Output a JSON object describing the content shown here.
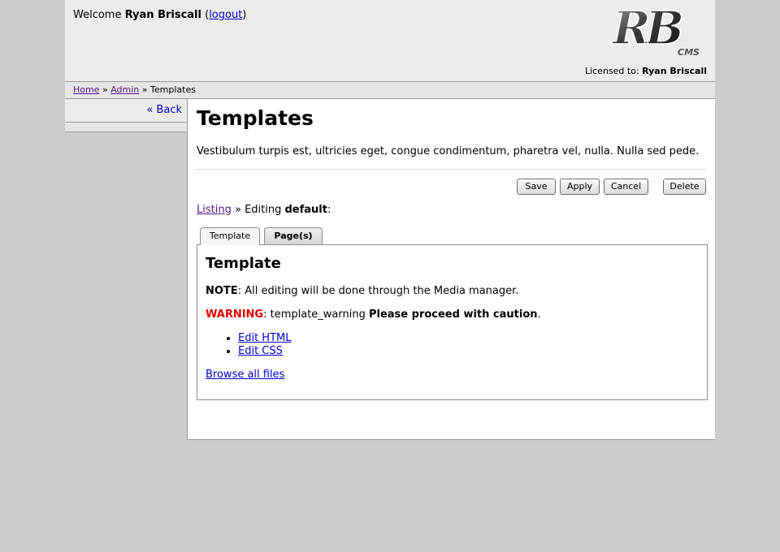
{
  "header": {
    "welcome_prefix": "Welcome",
    "user_name": "Ryan Briscall",
    "logout_label": "logout",
    "licensed_label": "Licensed to:",
    "licensed_name": "Ryan Briscall",
    "logo_text": "RB",
    "logo_subtext": "CMS"
  },
  "breadcrumb": {
    "items": [
      "Home",
      "Admin",
      "Templates"
    ],
    "separator": "»"
  },
  "sidebar": {
    "back_label": "« Back"
  },
  "main": {
    "title": "Templates",
    "intro": "Vestibulum turpis est, ultricies eget, congue condimentum, pharetra vel, nulla. Nulla sed pede.",
    "buttons": {
      "save": "Save",
      "apply": "Apply",
      "cancel": "Cancel",
      "delete": "Delete"
    },
    "listing": {
      "link_label": "Listing",
      "separator": "»",
      "editing_prefix": "Editing",
      "item_name": "default",
      "suffix": ":"
    },
    "tabs": [
      {
        "label": "Template",
        "active": true
      },
      {
        "label": "Page(s)",
        "active": false
      }
    ],
    "panel": {
      "title": "Template",
      "note_label": "NOTE",
      "note_text": ": All editing will be done through the Media manager.",
      "warning_label": "WARNING",
      "warning_text": ": template_warning ",
      "warning_emphasis": "Please proceed with caution",
      "warning_end": ".",
      "edit_links": [
        "Edit HTML",
        "Edit CSS"
      ],
      "browse_label": "Browse all files"
    }
  },
  "colors": {
    "page_background": "#cccccc",
    "header_background": "#ececec",
    "warning": "#e00000",
    "link": "#0000cc",
    "visited_link": "#551a8b"
  }
}
